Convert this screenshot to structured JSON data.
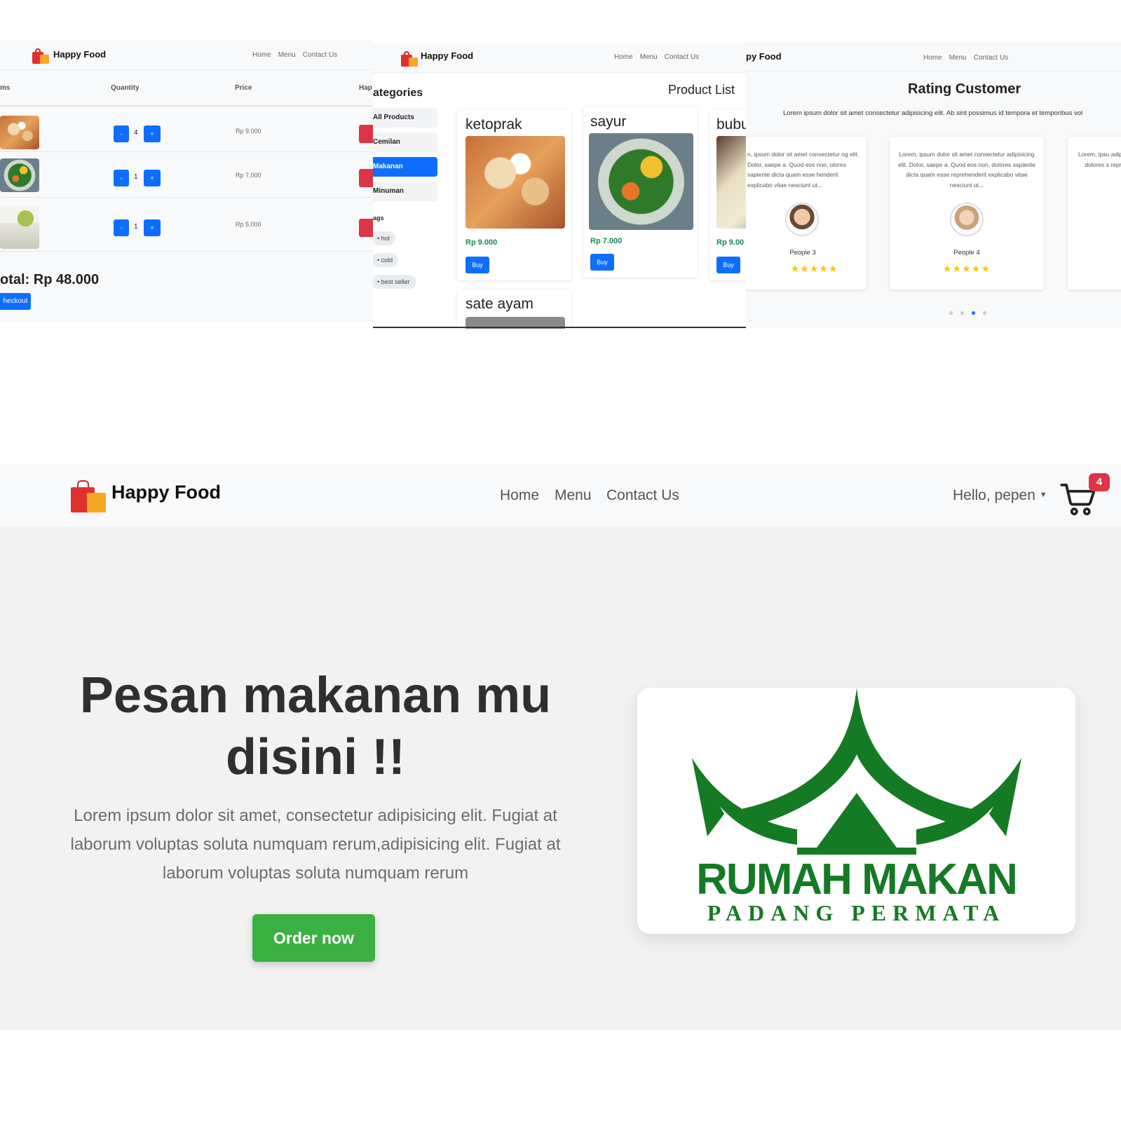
{
  "brand": {
    "name": "Happy Food"
  },
  "nav": {
    "home": "Home",
    "menu": "Menu",
    "contact": "Contact Us"
  },
  "cart_screen": {
    "col_items": "ms",
    "col_quantity": "Quantity",
    "col_price": "Price",
    "col_extra": "Hap",
    "rows": [
      {
        "qty": "4",
        "price": "Rp 9.000"
      },
      {
        "qty": "1",
        "price": "Rp 7.000"
      },
      {
        "qty": "1",
        "price": "Rp 5.000"
      }
    ],
    "minus": "-",
    "plus": "+",
    "total": "otal: Rp 48.000",
    "checkout": "heckout"
  },
  "menu_screen": {
    "categories_title": "ategories",
    "product_list_title": "Product List",
    "categories": [
      "All Products",
      "Cemilan",
      "Makanan",
      "Minuman"
    ],
    "active_category_index": 2,
    "tags_title": "ags",
    "tags": [
      "hot",
      "cold",
      "best seller"
    ],
    "products": [
      {
        "name": "ketoprak",
        "price": "Rp 9.000",
        "buy": "Buy"
      },
      {
        "name": "sayur",
        "price": "Rp 7.000",
        "buy": "Buy"
      },
      {
        "name": "bubu",
        "price": "Rp 9.00",
        "buy": "Buy"
      },
      {
        "name": "sate ayam"
      }
    ]
  },
  "rating_screen": {
    "brand_partial": "py Food",
    "title": "Rating Customer",
    "subtitle": "Lorem ipsum dolor sit amet consectetur adipisicing elit. Ab sint possimus id tempora et temporibus vol",
    "cards": [
      {
        "text": "n, ipsum dolor sit amet consectetur ng elit. Dolor, saepe a. Quod eos non, olores sapiente dicta quam esse henderit explicabo vitae nesciunt ut...",
        "name": "People 3",
        "stars": "★★★★★"
      },
      {
        "text": "Lorem, ipsum dolor sit amet consectetur adipisicing elit. Dolor, saepe a. Quod eos non, dolores sapiente dicta quam esse reprehenderit explicabo vitae nesciunt ut...",
        "name": "People 4",
        "stars": "★★★★★"
      },
      {
        "text": "Lorem, ipsu adipisicing elit. dolores s reprehender"
      }
    ],
    "active_dot_index": 2
  },
  "main": {
    "greeting": "Hello, pepen",
    "cart_count": "4",
    "hero_title": "Pesan makanan mu disini !!",
    "hero_text": "Lorem ipsum dolor sit amet, consectetur adipisicing elit. Fugiat at laborum voluptas soluta numquam rerum,adipisicing elit. Fugiat at laborum voluptas soluta numquam rerum",
    "order_button": "Order now",
    "logo_line1": "RUMAH MAKAN",
    "logo_line2": "PADANG PERMATA"
  },
  "colors": {
    "primary": "#0d6efd",
    "danger": "#dc3545",
    "success": "#3cb043",
    "logo_green": "#157a24"
  }
}
